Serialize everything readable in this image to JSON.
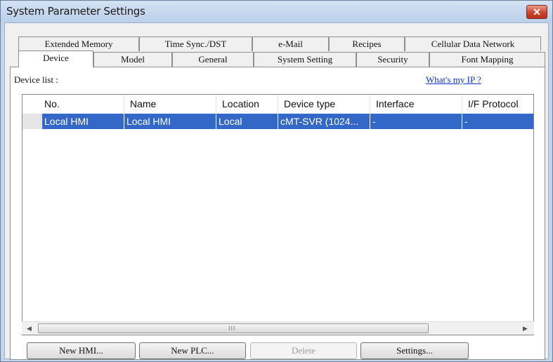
{
  "window": {
    "title": "System Parameter Settings",
    "close_symbol": "✕"
  },
  "tabs_top": [
    {
      "label": "Extended Memory"
    },
    {
      "label": "Time Sync./DST"
    },
    {
      "label": "e-Mail"
    },
    {
      "label": "Recipes"
    },
    {
      "label": "Cellular Data Network"
    }
  ],
  "tabs_bottom": [
    {
      "label": "Device",
      "active": true
    },
    {
      "label": "Model"
    },
    {
      "label": "General"
    },
    {
      "label": "System Setting"
    },
    {
      "label": "Security"
    },
    {
      "label": "Font Mapping"
    }
  ],
  "device_list": {
    "label": "Device list :",
    "whats_my_ip": "What's my IP ?",
    "columns": [
      "No.",
      "Name",
      "Location",
      "Device type",
      "Interface",
      "I/F Protocol"
    ],
    "rows": [
      [
        "Local HMI",
        "Local HMI",
        "Local",
        "cMT-SVR (1024...",
        "-",
        "-"
      ]
    ],
    "selection_color": "#3468c8",
    "scrollbar": {
      "left_arrow": "◀",
      "right_arrow": "▶",
      "grip": "III"
    }
  },
  "buttons": {
    "new_hmi": "New HMI...",
    "new_plc": "New PLC...",
    "delete": "Delete",
    "settings": "Settings..."
  }
}
